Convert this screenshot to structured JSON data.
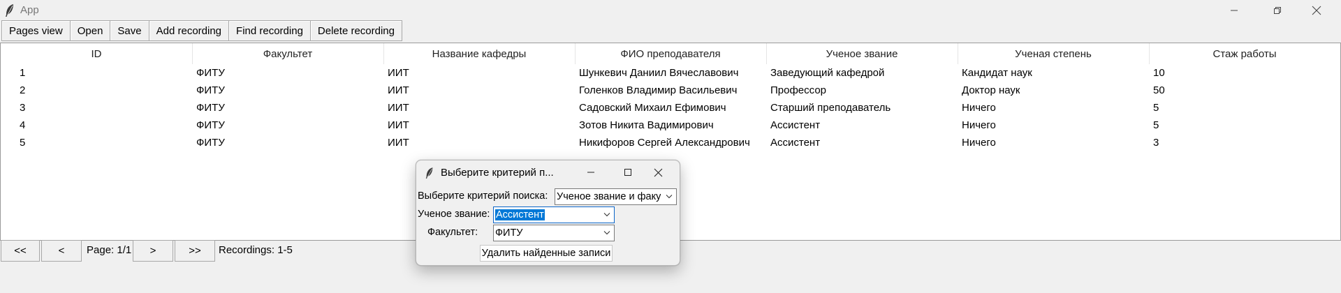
{
  "app": {
    "title": "App"
  },
  "toolbar": {
    "buttons": [
      "Pages view",
      "Open",
      "Save",
      "Add recording",
      "Find recording",
      "Delete recording"
    ]
  },
  "table": {
    "columns": [
      "ID",
      "Факультет",
      "Название кафедры",
      "ФИО преподавателя",
      "Ученое звание",
      "Ученая степень",
      "Стаж работы"
    ],
    "rows": [
      [
        "1",
        "ФИТУ",
        "ИИТ",
        "Шункевич Даниил Вячеславович",
        "Заведующий кафедрой",
        "Кандидат наук",
        "10"
      ],
      [
        "2",
        "ФИТУ",
        "ИИТ",
        "Голенков Владимир Васильевич",
        "Профессор",
        "Доктор наук",
        "50"
      ],
      [
        "3",
        "ФИТУ",
        "ИИТ",
        "Садовский Михаил Ефимович",
        "Старший преподаватель",
        "Ничего",
        "5"
      ],
      [
        "4",
        "ФИТУ",
        "ИИТ",
        "Зотов Никита Вадимирович",
        "Ассистент",
        "Ничего",
        "5"
      ],
      [
        "5",
        "ФИТУ",
        "ИИТ",
        "Никифоров Сергей Александрович",
        "Ассистент",
        "Ничего",
        "3"
      ]
    ]
  },
  "pager": {
    "first": "<<",
    "prev": "<",
    "page": "Page: 1/1",
    "next": ">",
    "last": ">>",
    "recordings": "Recordings: 1-5"
  },
  "dialog": {
    "title": "Выберите критерий п...",
    "criterion_label": "Выберите критерий поиска:",
    "criterion_value": "Ученое звание и факу",
    "rank_label": "Ученое звание:",
    "rank_value": "Ассистент",
    "faculty_label": "Факультет:",
    "faculty_value": "ФИТУ",
    "delete_button": "Удалить найденные записи"
  },
  "colors": {
    "selection": "#0078d7",
    "window_bg": "#f0f0f0",
    "table_bg": "#ffffff"
  },
  "icons": [
    "feather-icon",
    "minimize-icon",
    "restore-icon",
    "close-icon",
    "maximize-icon",
    "chevron-down-icon"
  ]
}
